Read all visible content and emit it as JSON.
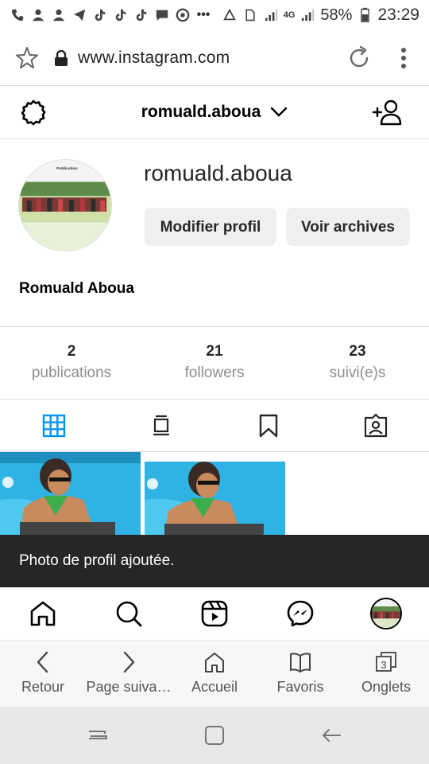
{
  "status_bar": {
    "battery": "58%",
    "time": "23:29",
    "network": "4G"
  },
  "browser": {
    "url": "www.instagram.com"
  },
  "header": {
    "username": "romuald.aboua"
  },
  "profile": {
    "username": "romuald.aboua",
    "edit_button": "Modifier profil",
    "archive_button": "Voir archives",
    "full_name": "Romuald Aboua",
    "avatar_caption": "Publication"
  },
  "stats": [
    {
      "count": "2",
      "label": "publications"
    },
    {
      "count": "21",
      "label": "followers"
    },
    {
      "count": "23",
      "label": "suivi(e)s"
    }
  ],
  "toast": {
    "message": "Photo de profil ajoutée."
  },
  "browser_nav": [
    {
      "label": "Retour"
    },
    {
      "label": "Page suiva…"
    },
    {
      "label": "Accueil"
    },
    {
      "label": "Favoris"
    },
    {
      "label": "Onglets",
      "count": "3"
    }
  ],
  "colors": {
    "accent": "#0095f6",
    "toast_bg": "#262626",
    "button_bg": "#efefef"
  }
}
